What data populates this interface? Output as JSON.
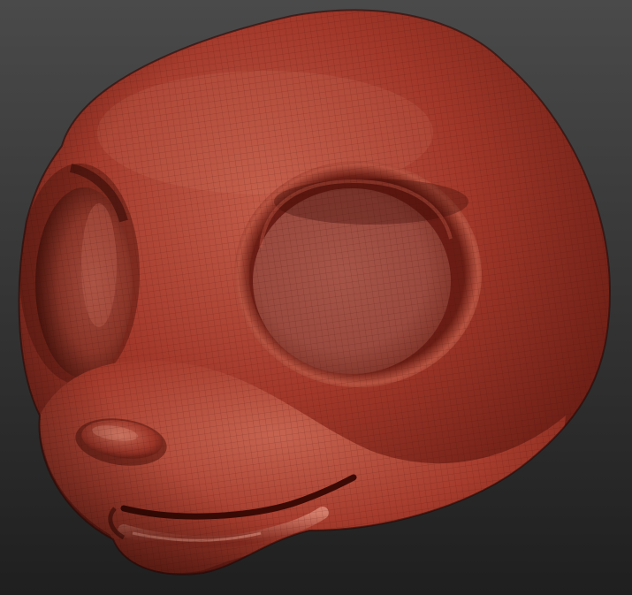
{
  "scene": {
    "subject": "sculpted-cartoon-animal-head",
    "background_gradient": [
      "#4a4a4a",
      "#1f1f1f"
    ],
    "material_colors": {
      "base": "#a2382a",
      "shadow": "#4a130d",
      "highlight": "#d47a66",
      "eye_socket": "#9a4a3f"
    },
    "features": {
      "head": {
        "visible": true
      },
      "left_eye_socket": {
        "visible": true
      },
      "right_eye_socket": {
        "visible": true
      },
      "nose": {
        "visible": true
      },
      "mouth": {
        "visible": true
      },
      "wireframe": {
        "visible": true
      }
    }
  }
}
